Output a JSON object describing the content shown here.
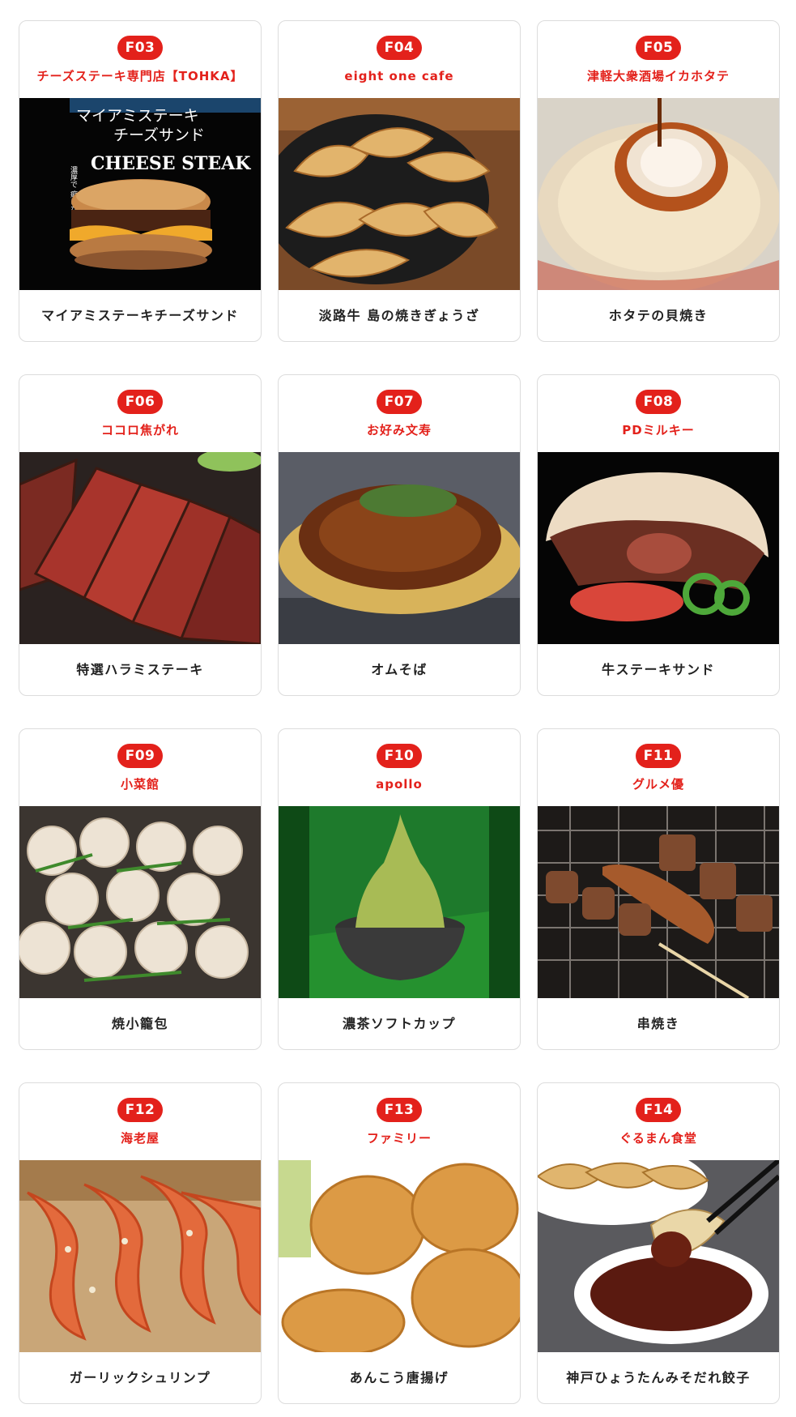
{
  "accent_color": "#e3211b",
  "cards": [
    {
      "code": "F03",
      "shop": "チーズステーキ専門店【TOHKA】",
      "item": "マイアミステーキチーズサンド",
      "photo_icon": "cheese-steak-sandwich-photo",
      "photo_text": {
        "line1": "マイアミステーキ",
        "line2": "チーズサンド",
        "line3": "CHEESE STEAK",
        "side": "濃厚で 癖になる。"
      }
    },
    {
      "code": "F04",
      "shop": "eight one cafe",
      "item": "淡路牛 島の焼きぎょうざ",
      "photo_icon": "gyoza-photo"
    },
    {
      "code": "F05",
      "shop": "津軽大衆酒場イカホタテ",
      "item": "ホタテの貝焼き",
      "photo_icon": "grilled-scallop-photo"
    },
    {
      "code": "F06",
      "shop": "ココロ焦がれ",
      "item": "特選ハラミステーキ",
      "photo_icon": "skirt-steak-photo"
    },
    {
      "code": "F07",
      "shop": "お好み文寿",
      "item": "オムそば",
      "photo_icon": "omusoba-photo"
    },
    {
      "code": "F08",
      "shop": "PDミルキー",
      "item": "牛ステーキサンド",
      "photo_icon": "steak-pita-sandwich-photo"
    },
    {
      "code": "F09",
      "shop": "小菜館",
      "item": "焼小籠包",
      "photo_icon": "xiaolongbao-photo"
    },
    {
      "code": "F10",
      "shop": "apollo",
      "item": "濃茶ソフトカップ",
      "photo_icon": "matcha-soft-serve-photo"
    },
    {
      "code": "F11",
      "shop": "グルメ優",
      "item": "串焼き",
      "photo_icon": "skewers-photo"
    },
    {
      "code": "F12",
      "shop": "海老屋",
      "item": "ガーリックシュリンプ",
      "photo_icon": "garlic-shrimp-photo"
    },
    {
      "code": "F13",
      "shop": "ファミリー",
      "item": "あんこう唐揚げ",
      "photo_icon": "fried-monkfish-photo"
    },
    {
      "code": "F14",
      "shop": "ぐるまん食堂",
      "item": "神戸ひょうたんみそだれ餃子",
      "photo_icon": "miso-dip-gyoza-photo"
    }
  ]
}
